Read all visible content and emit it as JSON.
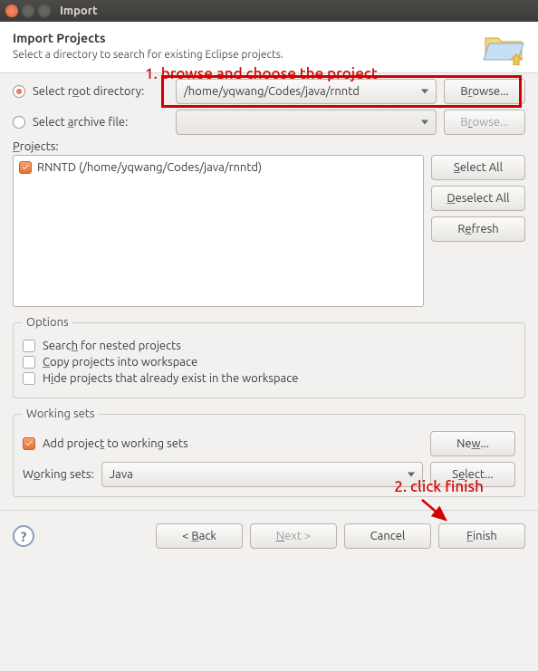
{
  "window": {
    "title": "Import"
  },
  "header": {
    "title": "Import Projects",
    "subtitle": "Select a directory to search for existing Eclipse projects."
  },
  "annotations": {
    "step1": "1. browse and choose the project",
    "step2": "2. click finish"
  },
  "source": {
    "root_label": "Select root directory:",
    "archive_label": "Select archive file:",
    "root_path": "/home/yqwang/Codes/java/rnntd",
    "browse_label": "Browse..."
  },
  "projects": {
    "label": "Projects:",
    "items": [
      {
        "label": "RNNTD (/home/yqwang/Codes/java/rnntd)",
        "checked": true
      }
    ],
    "select_all": "Select All",
    "deselect_all": "Deselect All",
    "refresh": "Refresh"
  },
  "options": {
    "legend": "Options",
    "nested": "Search for nested projects",
    "copy": "Copy projects into workspace",
    "hide": "Hide projects that already exist in the workspace"
  },
  "working_sets": {
    "legend": "Working sets",
    "add_label": "Add project to working sets",
    "new_label": "New...",
    "ws_label": "Working sets:",
    "ws_value": "Java",
    "select_label": "Select..."
  },
  "buttons": {
    "back": "< Back",
    "next": "Next >",
    "cancel": "Cancel",
    "finish": "Finish"
  }
}
